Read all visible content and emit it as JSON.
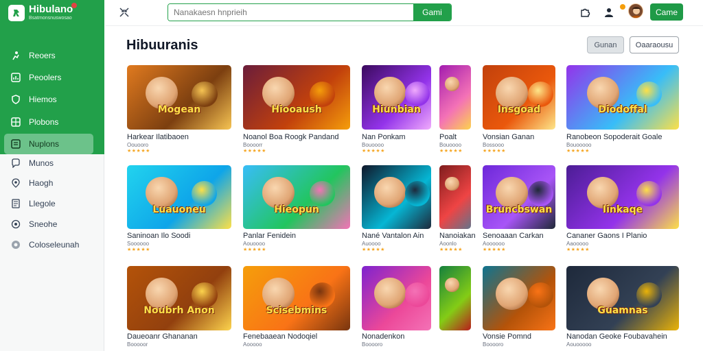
{
  "brand": {
    "name": "Hibulano",
    "subtitle": "Bsatmonsnuswosao"
  },
  "sidebar": {
    "items": [
      {
        "label": "Reoers",
        "icon": "run-icon"
      },
      {
        "label": "Peoolers",
        "icon": "chart-icon"
      },
      {
        "label": "Hiemos",
        "icon": "shield-icon"
      },
      {
        "label": "Plobons",
        "icon": "grid-icon"
      },
      {
        "label": "Nuplons",
        "icon": "list-icon",
        "active": true
      },
      {
        "label": "Munos",
        "icon": "chat-icon"
      },
      {
        "label": "Haogh",
        "icon": "pin-icon"
      },
      {
        "label": "Llegole",
        "icon": "doc-icon"
      },
      {
        "label": "Sneohe",
        "icon": "settings-icon"
      },
      {
        "label": "Coloseleunah",
        "icon": "help-icon"
      }
    ]
  },
  "topbar": {
    "search_placeholder": "Nanakaesn hnprieih",
    "search_button": "Gami",
    "game_button": "Came"
  },
  "main": {
    "title": "Hibuuranis",
    "filter_a": "Gunan",
    "filter_b": "Oaaraousu"
  },
  "colors": {
    "brand_green": "#22a04a",
    "active_item": "#6cc28a",
    "star": "#f5a623"
  },
  "games": [
    {
      "title": "Harkear Ilatibaoen",
      "meta": "Oouooro",
      "stars": "★★★★★",
      "art": "Mogean"
    },
    {
      "title": "Noanol Boa Roogk Pandand",
      "meta": "Boooorr",
      "stars": "★★★★★",
      "art": "Hiooaush"
    },
    {
      "title": "Nan Ponkam",
      "meta": "Bouoooo",
      "stars": "★★★★★",
      "art": "Hiunbian"
    },
    {
      "title": "Poalt",
      "meta": "Bouoooo",
      "stars": "★★★★★",
      "art": ""
    },
    {
      "title": "Vonsian Ganan",
      "meta": "Bossooo",
      "stars": "★★★★★",
      "art": "Insgoad"
    },
    {
      "title": "Ranobeon Sopoderait Goale",
      "meta": "Bouooooo",
      "stars": "★★★★★",
      "art": "Diodoffal"
    },
    {
      "title": "Saninoan Ilo Soodi",
      "meta": "Soooooo",
      "stars": "★★★★★",
      "art": "Luauoneu"
    },
    {
      "title": "Panlar Fenidein",
      "meta": "Aouoooo",
      "stars": "★★★★★",
      "art": "Hieopun"
    },
    {
      "title": "Nané Vantalon Ain",
      "meta": "Auoooo",
      "stars": "★★★★★",
      "art": ""
    },
    {
      "title": "Nanoiakan",
      "meta": "Aoonlo",
      "stars": "★★★★★",
      "art": ""
    },
    {
      "title": "Senoaaan Carkan",
      "meta": "Aoooooo",
      "stars": "★★★★★",
      "art": "Bruncbswan"
    },
    {
      "title": "Cananer Gaons I Planio",
      "meta": "Aaooooo",
      "stars": "★★★★★",
      "art": "Iinkaqe"
    },
    {
      "title": "Daueoanr Ghananan",
      "meta": "Booooor",
      "stars": "★★★★★",
      "art": "Noubrh Anon"
    },
    {
      "title": "Fenebaaean Nodoqiel",
      "meta": "Aooooo",
      "stars": "★★★★★",
      "art": "Scisebmins"
    },
    {
      "title": "Nonadenkon",
      "meta": "Booooro",
      "stars": "★★★★★",
      "art": ""
    },
    {
      "title": "",
      "meta": "",
      "stars": "",
      "art": ""
    },
    {
      "title": "Vonsie Pomnd",
      "meta": "Booooro",
      "stars": "★★★★★",
      "art": ""
    },
    {
      "title": "Nanodan Geoke Foubavahein",
      "meta": "Aouooooo",
      "stars": "★★★★★",
      "art": "Guamnas"
    }
  ]
}
